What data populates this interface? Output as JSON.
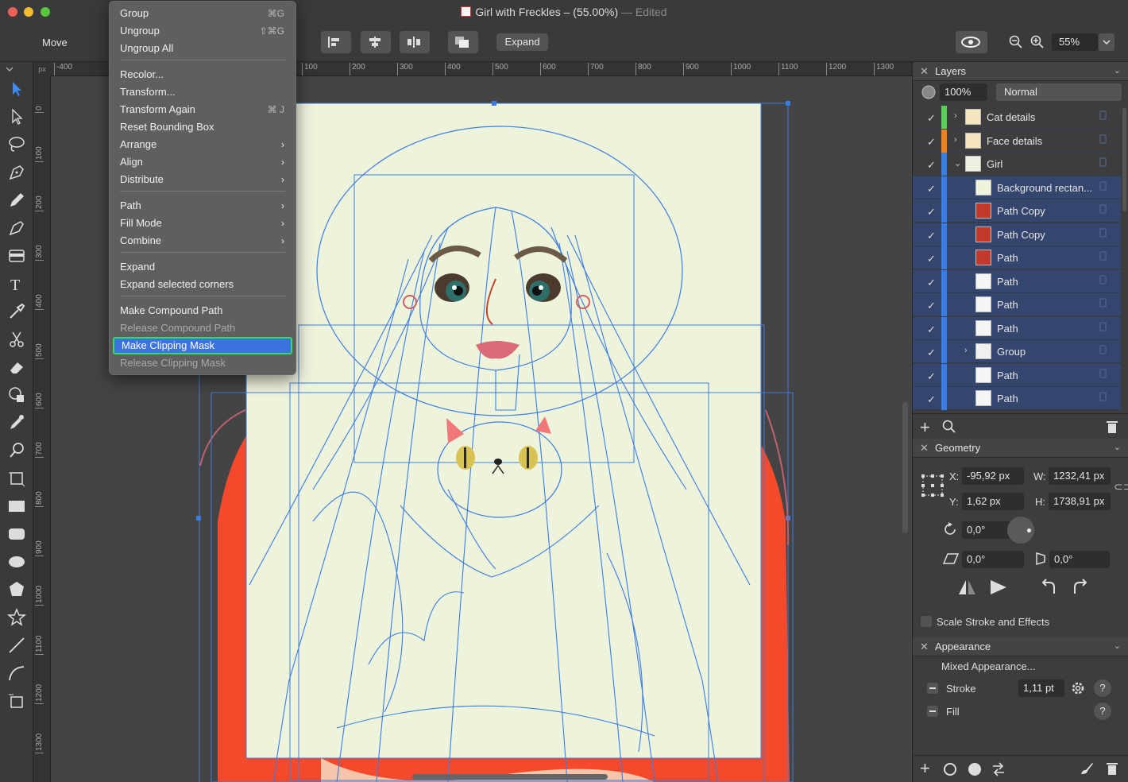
{
  "window": {
    "title": "Girl with Freckles – (55.00%)",
    "status": "Edited"
  },
  "toolbar": {
    "move_label": "Move",
    "expand_label": "Expand",
    "zoom": "55%"
  },
  "ruler": {
    "unit": "px",
    "h_ticks": [
      "-400",
      "100",
      "200",
      "300",
      "400",
      "500",
      "600",
      "700",
      "800",
      "900",
      "1000",
      "1100",
      "1200",
      "1300"
    ],
    "v_ticks": [
      "0",
      "100",
      "200",
      "300",
      "400",
      "500",
      "600",
      "700",
      "800",
      "900",
      "1000",
      "1100",
      "1200",
      "1300"
    ]
  },
  "menu": {
    "items": [
      {
        "label": "Group",
        "shortcut": "⌘G"
      },
      {
        "label": "Ungroup",
        "shortcut": "⇧⌘G"
      },
      {
        "label": "Ungroup All"
      },
      {
        "label": "Recolor..."
      },
      {
        "label": "Transform..."
      },
      {
        "label": "Transform Again",
        "shortcut": "⌘ J"
      },
      {
        "label": "Reset Bounding Box"
      },
      {
        "label": "Arrange",
        "submenu": "›"
      },
      {
        "label": "Align",
        "submenu": "›"
      },
      {
        "label": "Distribute",
        "submenu": "›"
      },
      {
        "label": "Path",
        "submenu": "›"
      },
      {
        "label": "Fill Mode",
        "submenu": "›"
      },
      {
        "label": "Combine",
        "submenu": "›"
      },
      {
        "label": "Expand"
      },
      {
        "label": "Expand selected corners"
      },
      {
        "label": "Make Compound Path"
      },
      {
        "label": "Release Compound Path"
      },
      {
        "label": "Make Clipping Mask"
      },
      {
        "label": "Release Clipping Mask"
      }
    ]
  },
  "layers": {
    "title": "Layers",
    "opacity": "100%",
    "blend": "Normal",
    "items": [
      {
        "label": "Cat details",
        "color": "#5ad05a"
      },
      {
        "label": "Face details",
        "color": "#f0821e"
      },
      {
        "label": "Girl",
        "color": "#3a7de0"
      },
      {
        "label": "Background rectan...",
        "color": "#3a7de0"
      },
      {
        "label": "Path Copy",
        "color": "#3a7de0"
      },
      {
        "label": "Path Copy",
        "color": "#3a7de0"
      },
      {
        "label": "Path",
        "color": "#3a7de0"
      },
      {
        "label": "Path",
        "color": "#3a7de0"
      },
      {
        "label": "Path",
        "color": "#3a7de0"
      },
      {
        "label": "Path",
        "color": "#3a7de0"
      },
      {
        "label": "Group",
        "color": "#3a7de0"
      },
      {
        "label": "Path",
        "color": "#3a7de0"
      },
      {
        "label": "Path",
        "color": "#3a7de0"
      }
    ]
  },
  "geometry": {
    "title": "Geometry",
    "x_label": "X:",
    "x": "-95,92 px",
    "y_label": "Y:",
    "y": "1,62 px",
    "w_label": "W:",
    "w": "1232,41 px",
    "h_label": "H:",
    "h": "1738,91 px",
    "rotation": "0,0°",
    "shear": "0,0°",
    "angle2": "0,0°",
    "scale_label": "Scale Stroke and Effects"
  },
  "appearance": {
    "title": "Appearance",
    "mixed": "Mixed Appearance...",
    "stroke_label": "Stroke",
    "stroke_value": "1,11 pt",
    "fill_label": "Fill",
    "help": "?"
  }
}
